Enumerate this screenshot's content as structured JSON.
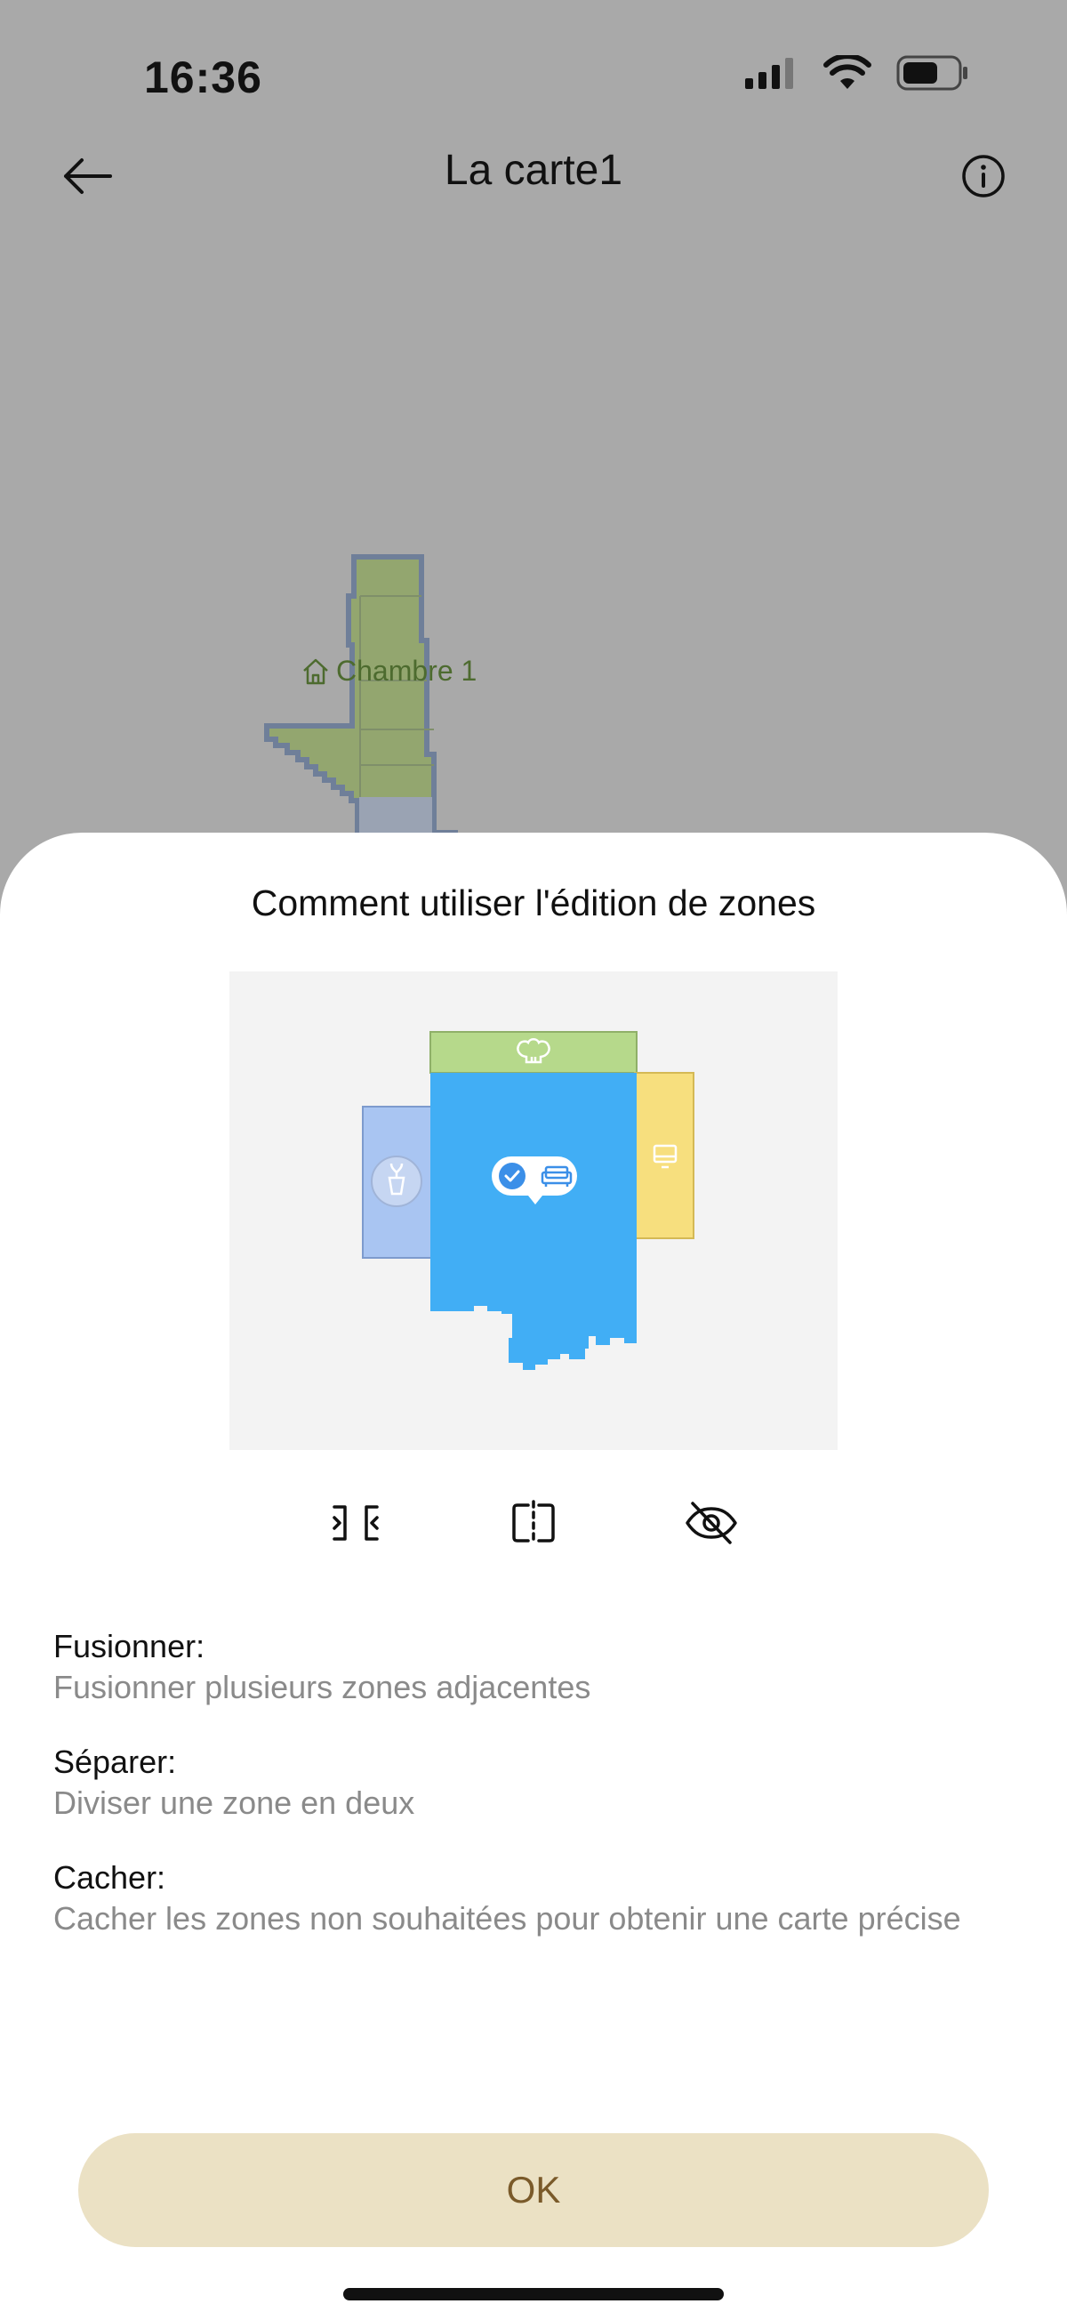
{
  "status_bar": {
    "time": "16:36",
    "icons": [
      "signal-icon",
      "wifi-icon",
      "battery-icon"
    ]
  },
  "header": {
    "title": "La carte1",
    "back_icon": "arrow-left-icon",
    "info_icon": "info-icon"
  },
  "map": {
    "room_label": "Chambre 1",
    "room_icon": "home-icon",
    "room_color": "#93a66f"
  },
  "sheet": {
    "title": "Comment utiliser l'édition de zones",
    "tools": [
      {
        "name": "merge",
        "icon": "merge-icon"
      },
      {
        "name": "split",
        "icon": "split-icon"
      },
      {
        "name": "hide",
        "icon": "eye-off-icon"
      }
    ],
    "descriptions": [
      {
        "title": "Fusionner:",
        "text": "Fusionner plusieurs zones adjacentes"
      },
      {
        "title": "Séparer:",
        "text": "Diviser une zone en deux"
      },
      {
        "title": "Cacher:",
        "text": "Cacher les zones non souhaitées pour obtenir une carte précise"
      }
    ],
    "ok_label": "OK"
  },
  "colors": {
    "overlay": "#a9a9a9",
    "accent_button": "#ebe1c4",
    "accent_text": "#7a5a2a",
    "zone_blue": "#41aef5",
    "zone_green": "#b6d98b",
    "zone_yellow": "#f7df7e",
    "zone_lightblue": "#a9c5f2"
  }
}
